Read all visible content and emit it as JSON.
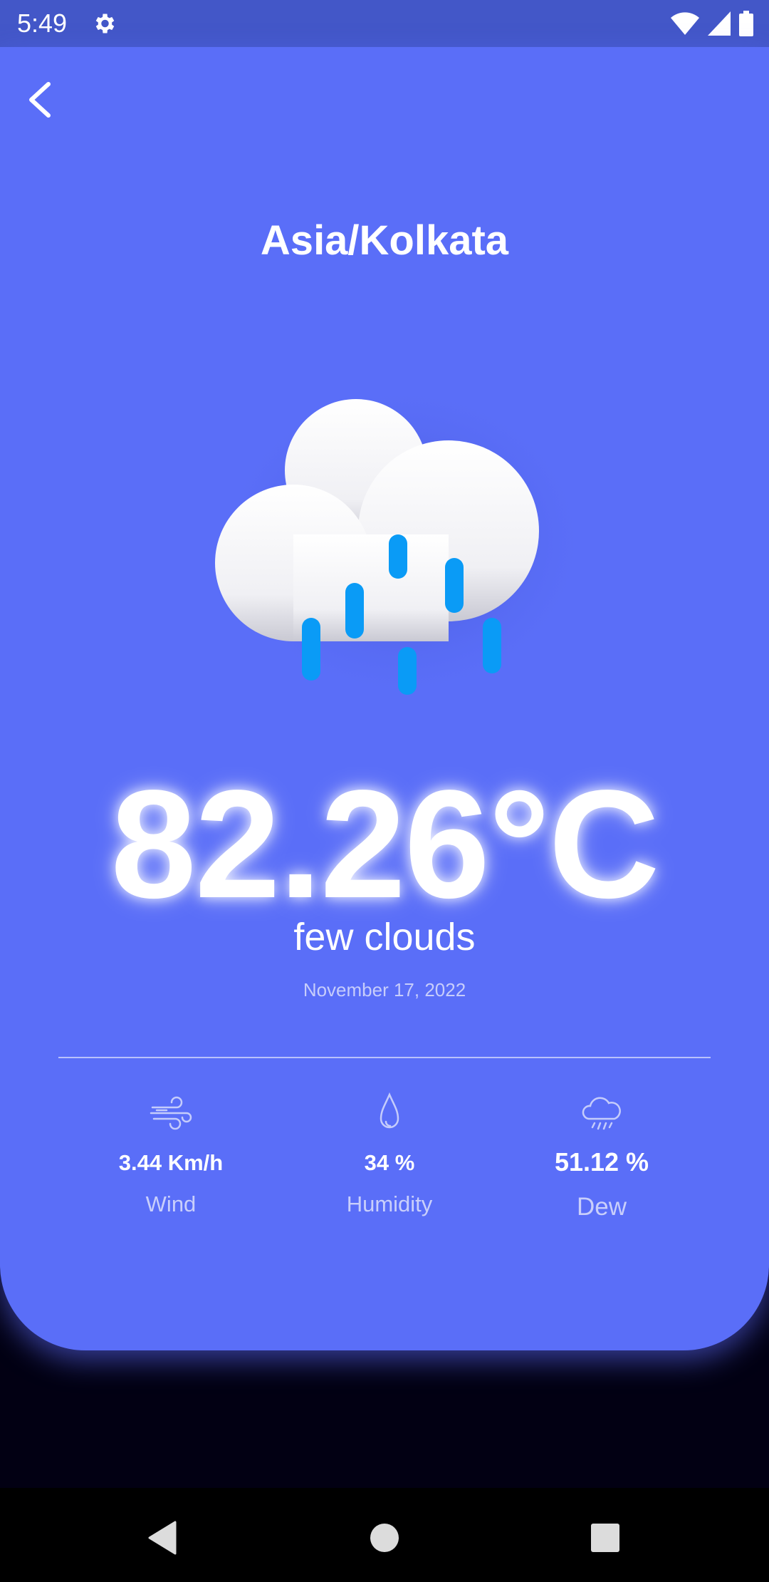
{
  "status_bar": {
    "time": "5:49",
    "icons": [
      "settings-icon",
      "wifi-icon",
      "signal-icon",
      "battery-icon"
    ]
  },
  "header": {
    "back_icon": "chevron-left-icon",
    "location": "Asia/Kolkata"
  },
  "weather": {
    "icon": "rain-cloud-icon",
    "temperature": "82.26°C",
    "condition": "few clouds",
    "date": "November 17, 2022"
  },
  "stats": {
    "wind": {
      "icon": "wind-icon",
      "value": "3.44 Km/h",
      "label": "Wind"
    },
    "humidity": {
      "icon": "droplet-icon",
      "value": "34 %",
      "label": "Humidity"
    },
    "dew": {
      "icon": "rain-cloud-outline-icon",
      "value": "51.12 %",
      "label": "Dew"
    }
  },
  "nav_bar": {
    "buttons": [
      "back-triangle-icon",
      "home-circle-icon",
      "recents-square-icon"
    ]
  },
  "colors": {
    "card": "#5a6ef8",
    "status_bar": "#4357c8",
    "background": "#020013",
    "rain": "#0a9bf6"
  }
}
